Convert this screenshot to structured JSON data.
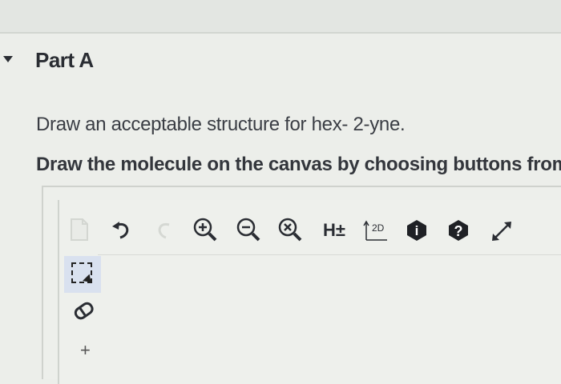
{
  "part": {
    "title": "Part A"
  },
  "question": {
    "prompt": "Draw an acceptable structure for hex- 2-yne.",
    "instruction": "Draw the molecule on the canvas by choosing buttons from"
  },
  "toolbar": {
    "tools": [
      {
        "name": "new-document-icon",
        "state": "disabled"
      },
      {
        "name": "undo-icon",
        "state": "enabled"
      },
      {
        "name": "redo-icon",
        "state": "disabled"
      },
      {
        "name": "zoom-in-icon",
        "state": "enabled"
      },
      {
        "name": "zoom-out-icon",
        "state": "enabled"
      },
      {
        "name": "zoom-reset-icon",
        "state": "enabled"
      },
      {
        "name": "hydrogen-toggle-icon",
        "label": "H±"
      },
      {
        "name": "clean-2d-icon",
        "label": "2D"
      },
      {
        "name": "info-icon",
        "label": "i"
      },
      {
        "name": "help-icon",
        "label": "?"
      },
      {
        "name": "fullscreen-icon"
      }
    ]
  },
  "sidebar": {
    "tools": [
      {
        "name": "select-tool-icon",
        "state": "active"
      },
      {
        "name": "eraser-icon"
      },
      {
        "name": "add-atom-icon",
        "label": "+"
      }
    ]
  },
  "colors": {
    "active_tool_bg": "#d9e1ef",
    "icon": "#2a2d33",
    "disabled_icon": "#d3d6d1"
  }
}
